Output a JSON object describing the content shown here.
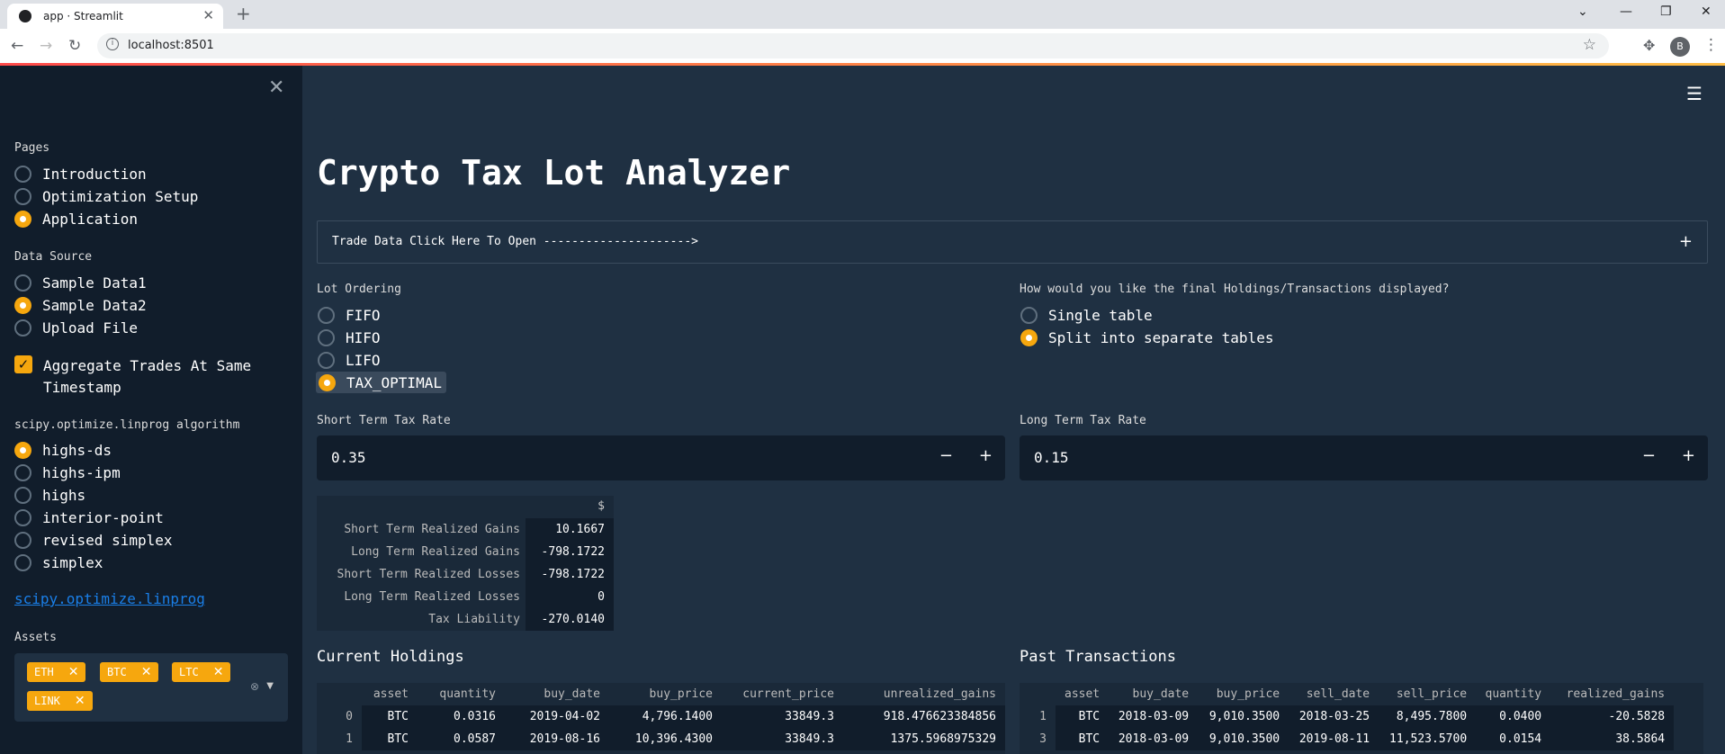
{
  "browser": {
    "tab_title": "app · Streamlit",
    "url": "localhost:8501",
    "profile_initial": "B"
  },
  "sidebar": {
    "pages_label": "Pages",
    "pages": [
      "Introduction",
      "Optimization Setup",
      "Application"
    ],
    "pages_selected": 2,
    "data_source_label": "Data Source",
    "data_sources": [
      "Sample Data1",
      "Sample Data2",
      "Upload File"
    ],
    "data_source_selected": 1,
    "aggregate_label": "Aggregate Trades At Same Timestamp",
    "aggregate_checked": true,
    "algorithm_label": "scipy.optimize.linprog algorithm",
    "algorithms": [
      "highs-ds",
      "highs-ipm",
      "highs",
      "interior-point",
      "revised simplex",
      "simplex"
    ],
    "algorithm_selected": 0,
    "link_text": "scipy.optimize.linprog",
    "assets_label": "Assets",
    "assets": [
      "ETH",
      "BTC",
      "LTC",
      "LINK"
    ]
  },
  "main": {
    "title": "Crypto Tax Lot Analyzer",
    "expander_label": "Trade Data Click Here To Open --------------------->",
    "lot_ordering_label": "Lot Ordering",
    "lot_orderings": [
      "FIFO",
      "HIFO",
      "LIFO",
      "TAX_OPTIMAL"
    ],
    "lot_ordering_selected": 3,
    "display_label": "How would you like the final Holdings/Transactions displayed?",
    "display_options": [
      "Single table",
      "Split into separate tables"
    ],
    "display_selected": 1,
    "short_rate_label": "Short Term Tax Rate",
    "short_rate_value": "0.35",
    "long_rate_label": "Long Term Tax Rate",
    "long_rate_value": "0.15",
    "stats_header": "$",
    "stats": [
      {
        "label": "Short Term Realized Gains",
        "value": "10.1667"
      },
      {
        "label": "Long Term Realized Gains",
        "value": "-798.1722"
      },
      {
        "label": "Short Term Realized Losses",
        "value": "-798.1722"
      },
      {
        "label": "Long Term Realized Losses",
        "value": "0"
      },
      {
        "label": "Tax Liability",
        "value": "-270.0140"
      }
    ],
    "holdings_title": "Current Holdings",
    "holdings_columns": [
      "",
      "asset",
      "quantity",
      "buy_date",
      "buy_price",
      "current_price",
      "unrealized_gains"
    ],
    "holdings_rows": [
      [
        "0",
        "BTC",
        "0.0316",
        "2019-04-02",
        "4,796.1400",
        "33849.3",
        "918.476623384856"
      ],
      [
        "1",
        "BTC",
        "0.0587",
        "2019-08-16",
        "10,396.4300",
        "33849.3",
        "1375.5968975329"
      ]
    ],
    "transactions_title": "Past Transactions",
    "transactions_columns": [
      "",
      "asset",
      "buy_date",
      "buy_price",
      "sell_date",
      "sell_price",
      "quantity",
      "realized_gains"
    ],
    "transactions_rows": [
      [
        "1",
        "BTC",
        "2018-03-09",
        "9,010.3500",
        "2018-03-25",
        "8,495.7800",
        "0.0400",
        "-20.5828"
      ],
      [
        "3",
        "BTC",
        "2018-03-09",
        "9,010.3500",
        "2019-08-11",
        "11,523.5700",
        "0.0154",
        "38.5864"
      ]
    ]
  },
  "colors": {
    "accent": "#f6a70e",
    "background": "#1f3042",
    "sidebar": "#111d2b",
    "link": "#1a7fe8"
  }
}
